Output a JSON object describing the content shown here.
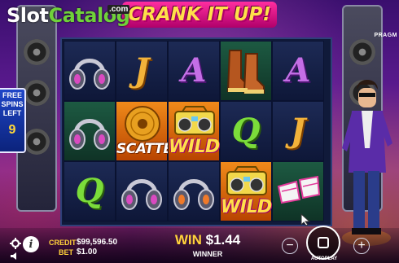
{
  "watermark": {
    "word1": "Slot",
    "word2": "Catalog",
    "suffix": ".com"
  },
  "game": {
    "title": "CRANK IT UP!",
    "provider": "PRAGM"
  },
  "free_spins": {
    "line1": "FREE",
    "line2": "SPINS",
    "line3": "LEFT",
    "count": "9"
  },
  "grid": {
    "rows": [
      [
        {
          "symbol": "headphones-icon"
        },
        {
          "symbol": "J",
          "text": "J"
        },
        {
          "symbol": "A",
          "text": "A"
        },
        {
          "symbol": "boots-icon"
        },
        {
          "symbol": "A",
          "text": "A"
        }
      ],
      [
        {
          "symbol": "headphones-icon"
        },
        {
          "symbol": "scatter",
          "text": "SCATTER"
        },
        {
          "symbol": "wild",
          "text": "WILD"
        },
        {
          "symbol": "Q",
          "text": "Q"
        },
        {
          "symbol": "J",
          "text": "J"
        }
      ],
      [
        {
          "symbol": "Q",
          "text": "Q"
        },
        {
          "symbol": "headphones-icon"
        },
        {
          "symbol": "headphones-icon"
        },
        {
          "symbol": "wild",
          "text": "WILD"
        },
        {
          "symbol": "sunglasses-icon"
        }
      ]
    ]
  },
  "bottom_bar": {
    "credit_label": "CREDIT",
    "credit_value": "$99,596.50",
    "bet_label": "BET",
    "bet_value": "$1.00",
    "win_label": "WIN",
    "win_value": "$1.44",
    "status_text": "WINNER",
    "autoplay_label": "AUTOPLAY"
  },
  "colors": {
    "accent": "#ffd23a",
    "brand_green": "#6fd13a"
  }
}
